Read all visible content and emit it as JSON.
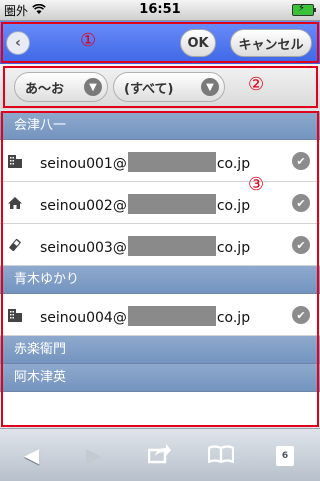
{
  "status_bar": {
    "carrier": "圏外",
    "time": "16:51"
  },
  "header": {
    "marker": "①",
    "ok_label": "OK",
    "cancel_label": "キャンセル"
  },
  "filters": {
    "marker": "②",
    "kana_value": "あ～お",
    "category_value": "(すべて)"
  },
  "list": {
    "marker": "③",
    "groups": [
      {
        "name": "会津八一"
      },
      {
        "name": "青木ゆかり"
      },
      {
        "name": "赤楽衛門"
      },
      {
        "name": "阿木津英"
      }
    ],
    "rows": [
      {
        "icon": "building-icon",
        "email_user": "seinou001@",
        "email_domain": "co.jp"
      },
      {
        "icon": "home-icon",
        "email_user": "seinou002@",
        "email_domain": "co.jp"
      },
      {
        "icon": "mobile-icon",
        "email_user": "seinou003@",
        "email_domain": "co.jp"
      },
      {
        "icon": "building-icon",
        "email_user": "seinou004@",
        "email_domain": "co.jp"
      }
    ]
  },
  "toolbar": {
    "tab_count": "6"
  },
  "colors": {
    "header_blue": "#4a70ea",
    "group_header": "#7f9cc5",
    "annotation_red": "#e0001a"
  }
}
